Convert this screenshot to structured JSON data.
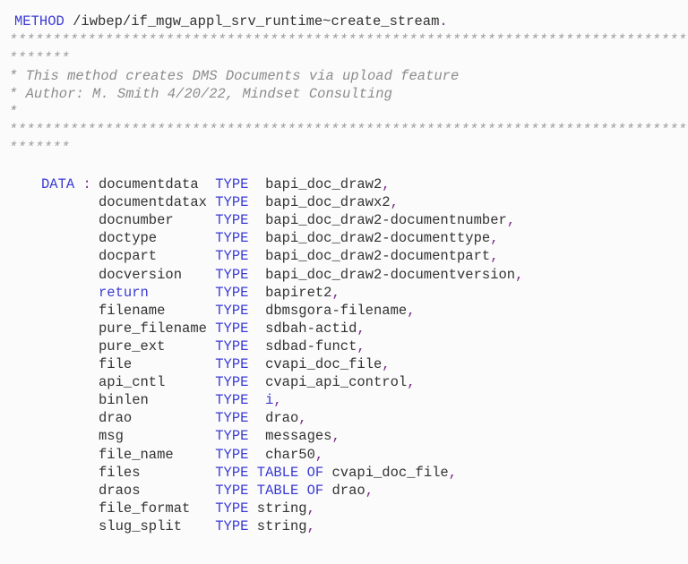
{
  "code": {
    "language": "ABAP",
    "header": {
      "method_keyword": "METHOD",
      "method_name": "/iwbep/if_mgw_appl_srv_runtime~create_stream",
      "terminator": "."
    },
    "comment_block": {
      "border_line_1a": "******************************************************************************",
      "border_line_1b": "*******",
      "comment_1": "* This method creates DMS Documents via upload feature",
      "comment_2": "* Author: M. Smith 4/20/22, Mindset Consulting",
      "comment_3": "*",
      "border_line_2a": "******************************************************************************",
      "border_line_2b": "*******"
    },
    "data_declaration": {
      "keyword": "DATA",
      "colon": ":",
      "type_keyword": "TYPE",
      "table_of_keyword": "TABLE OF",
      "separator": ",",
      "fields": [
        {
          "name": "documentdata",
          "type": "bapi_doc_draw2",
          "table_of": false
        },
        {
          "name": "documentdatax",
          "type": "bapi_doc_drawx2",
          "table_of": false
        },
        {
          "name": "docnumber",
          "type": "bapi_doc_draw2-documentnumber",
          "table_of": false
        },
        {
          "name": "doctype",
          "type": "bapi_doc_draw2-documenttype",
          "table_of": false
        },
        {
          "name": "docpart",
          "type": "bapi_doc_draw2-documentpart",
          "table_of": false
        },
        {
          "name": "docversion",
          "type": "bapi_doc_draw2-documentversion",
          "table_of": false
        },
        {
          "name": "return",
          "type": "bapiret2",
          "table_of": false
        },
        {
          "name": "filename",
          "type": "dbmsgora-filename",
          "table_of": false
        },
        {
          "name": "pure_filename",
          "type": "sdbah-actid",
          "table_of": false
        },
        {
          "name": "pure_ext",
          "type": "sdbad-funct",
          "table_of": false
        },
        {
          "name": "file",
          "type": "cvapi_doc_file",
          "table_of": false
        },
        {
          "name": "api_cntl",
          "type": "cvapi_api_control",
          "table_of": false
        },
        {
          "name": "binlen",
          "type": "i",
          "table_of": false
        },
        {
          "name": "drao",
          "type": "drao",
          "table_of": false
        },
        {
          "name": "msg",
          "type": "messages",
          "table_of": false
        },
        {
          "name": "file_name",
          "type": "char50",
          "table_of": false
        },
        {
          "name": "files",
          "type": "cvapi_doc_file",
          "table_of": true
        },
        {
          "name": "draos",
          "type": "drao",
          "table_of": true
        },
        {
          "name": "file_format",
          "type": "string",
          "table_of": false
        },
        {
          "name": "slug_split",
          "type": "string",
          "table_of": false
        }
      ]
    },
    "colors": {
      "keyword": "#3a3ad6",
      "punctuation": "#7a2a8a",
      "comment": "#8c8c8c",
      "text": "#333333",
      "background": "#fbfbfb"
    }
  }
}
